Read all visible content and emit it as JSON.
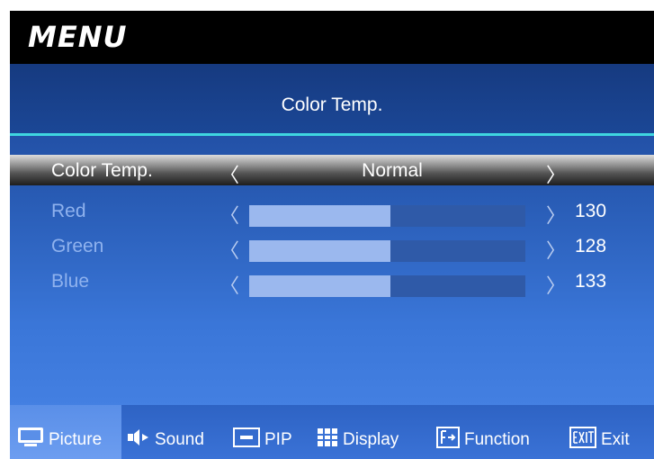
{
  "header": {
    "title": "MENU"
  },
  "page": {
    "subtitle": "Color Temp."
  },
  "settings": {
    "color_temp": {
      "label": "Color Temp.",
      "value": "Normal",
      "left_arrow": "〈",
      "right_arrow": "〉"
    },
    "rows": [
      {
        "label": "Red",
        "value": "130",
        "fill_fraction": 0.51
      },
      {
        "label": "Green",
        "value": "128",
        "fill_fraction": 0.51
      },
      {
        "label": "Blue",
        "value": "133",
        "fill_fraction": 0.51
      }
    ],
    "left_arrow": "〈",
    "right_arrow": "〉"
  },
  "bottom_tabs": [
    {
      "label": "Picture",
      "icon": "monitor-icon",
      "active": true
    },
    {
      "label": "Sound",
      "icon": "speaker-icon",
      "active": false
    },
    {
      "label": "PIP",
      "icon": "pip-icon",
      "active": false
    },
    {
      "label": "Display",
      "icon": "grid-icon",
      "active": false
    },
    {
      "label": "Function",
      "icon": "function-icon",
      "active": false
    },
    {
      "label": "Exit",
      "icon": "exit-icon",
      "active": false
    }
  ],
  "colors": {
    "accent_rule": "#3fd6e0",
    "slider_fill": "#9bb8ee",
    "slider_track": "#2f5aa8",
    "header_bg": "#000000"
  }
}
